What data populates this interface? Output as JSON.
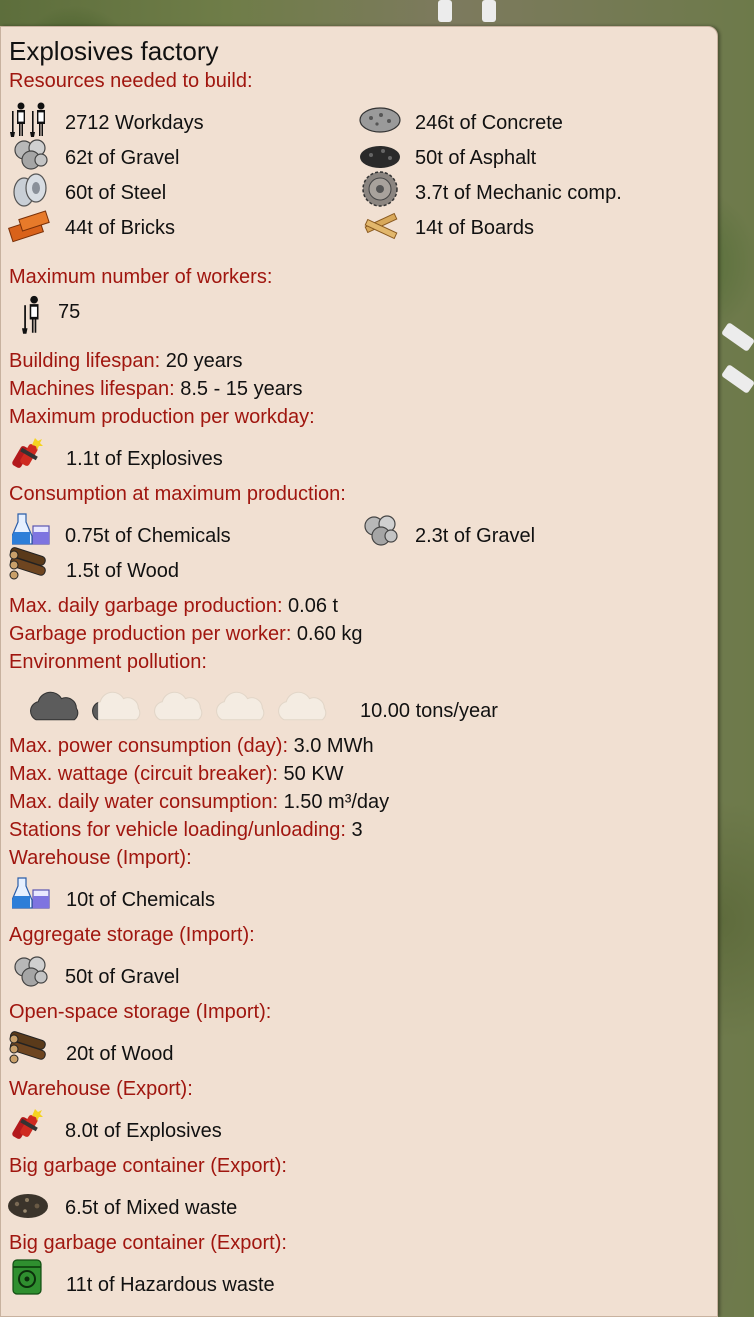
{
  "title": "Explosives factory",
  "sections": {
    "resources_header": "Resources needed to build:",
    "resources": [
      {
        "text": "2712 Workdays",
        "icon": "workers-icon"
      },
      {
        "text": "246t of Concrete",
        "icon": "concrete-icon"
      },
      {
        "text": "62t of Gravel",
        "icon": "gravel-icon"
      },
      {
        "text": "50t of Asphalt",
        "icon": "asphalt-icon"
      },
      {
        "text": "60t of Steel",
        "icon": "steel-icon"
      },
      {
        "text": "3.7t of Mechanic comp.",
        "icon": "gear-icon"
      },
      {
        "text": "44t of Bricks",
        "icon": "bricks-icon"
      },
      {
        "text": "14t of Boards",
        "icon": "boards-icon"
      }
    ],
    "max_workers_header": "Maximum number of workers:",
    "max_workers_value": "75",
    "building_lifespan_label": "Building lifespan:",
    "building_lifespan_value": " 20 years",
    "machines_lifespan_label": "Machines lifespan:",
    "machines_lifespan_value": " 8.5 - 15 years",
    "max_production_header": "Maximum production per workday:",
    "production": "1.1t of Explosives",
    "consumption_header": "Consumption at maximum production:",
    "consumption": [
      {
        "text": "0.75t of Chemicals",
        "icon": "chemicals-icon"
      },
      {
        "text": "2.3t of Gravel",
        "icon": "gravel-icon"
      },
      {
        "text": "1.5t of Wood",
        "icon": "wood-icon"
      }
    ],
    "garbage_daily_label": "Max. daily garbage production:",
    "garbage_daily_value": " 0.06 t",
    "garbage_worker_label": "Garbage production per worker:",
    "garbage_worker_value": " 0.60 kg",
    "pollution_header": "Environment pollution:",
    "pollution_value": "10.00 tons/year",
    "pollution_level_clouds": 1.2,
    "pollution_max_clouds": 5,
    "power_label": "Max. power consumption (day):",
    "power_value": " 3.0 MWh",
    "wattage_label": "Max. wattage (circuit breaker):",
    "wattage_value": " 50 KW",
    "water_label": "Max. daily water consumption:",
    "water_value": " 1.50 m³/day",
    "stations_label": "Stations for vehicle loading/unloading:",
    "stations_value": " 3",
    "storages": [
      {
        "header": "Warehouse (Import):",
        "text": "10t of Chemicals",
        "icon": "chemicals-icon"
      },
      {
        "header": "Aggregate storage (Import):",
        "text": "50t of Gravel",
        "icon": "gravel-icon"
      },
      {
        "header": "Open-space storage (Import):",
        "text": "20t of Wood",
        "icon": "wood-icon"
      },
      {
        "header": "Warehouse (Export):",
        "text": "8.0t of Explosives",
        "icon": "explosives-icon"
      },
      {
        "header": "Big garbage container (Export):",
        "text": "6.5t of Mixed waste",
        "icon": "mixed-waste-icon"
      },
      {
        "header": "Big garbage container (Export):",
        "text": "11t of Hazardous waste",
        "icon": "hazardous-waste-icon"
      }
    ]
  },
  "colors": {
    "header": "#a0160f",
    "text": "#111111",
    "panel": "#f1e0d2"
  }
}
